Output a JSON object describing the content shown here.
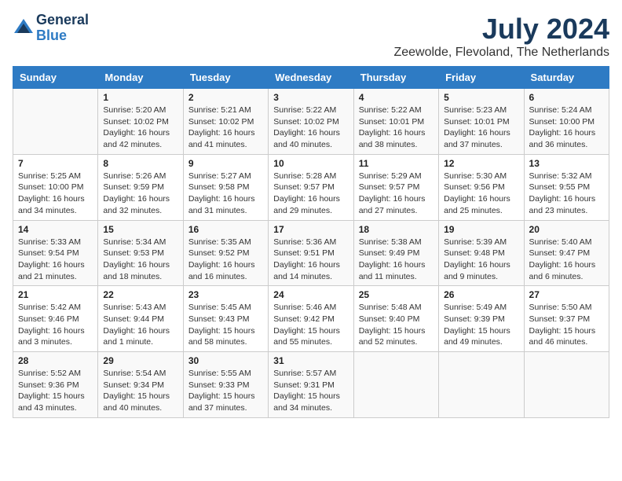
{
  "header": {
    "logo_general": "General",
    "logo_blue": "Blue",
    "month_title": "July 2024",
    "location": "Zeewolde, Flevoland, The Netherlands"
  },
  "weekdays": [
    "Sunday",
    "Monday",
    "Tuesday",
    "Wednesday",
    "Thursday",
    "Friday",
    "Saturday"
  ],
  "weeks": [
    [
      {
        "day": "",
        "info": ""
      },
      {
        "day": "1",
        "info": "Sunrise: 5:20 AM\nSunset: 10:02 PM\nDaylight: 16 hours\nand 42 minutes."
      },
      {
        "day": "2",
        "info": "Sunrise: 5:21 AM\nSunset: 10:02 PM\nDaylight: 16 hours\nand 41 minutes."
      },
      {
        "day": "3",
        "info": "Sunrise: 5:22 AM\nSunset: 10:02 PM\nDaylight: 16 hours\nand 40 minutes."
      },
      {
        "day": "4",
        "info": "Sunrise: 5:22 AM\nSunset: 10:01 PM\nDaylight: 16 hours\nand 38 minutes."
      },
      {
        "day": "5",
        "info": "Sunrise: 5:23 AM\nSunset: 10:01 PM\nDaylight: 16 hours\nand 37 minutes."
      },
      {
        "day": "6",
        "info": "Sunrise: 5:24 AM\nSunset: 10:00 PM\nDaylight: 16 hours\nand 36 minutes."
      }
    ],
    [
      {
        "day": "7",
        "info": "Sunrise: 5:25 AM\nSunset: 10:00 PM\nDaylight: 16 hours\nand 34 minutes."
      },
      {
        "day": "8",
        "info": "Sunrise: 5:26 AM\nSunset: 9:59 PM\nDaylight: 16 hours\nand 32 minutes."
      },
      {
        "day": "9",
        "info": "Sunrise: 5:27 AM\nSunset: 9:58 PM\nDaylight: 16 hours\nand 31 minutes."
      },
      {
        "day": "10",
        "info": "Sunrise: 5:28 AM\nSunset: 9:57 PM\nDaylight: 16 hours\nand 29 minutes."
      },
      {
        "day": "11",
        "info": "Sunrise: 5:29 AM\nSunset: 9:57 PM\nDaylight: 16 hours\nand 27 minutes."
      },
      {
        "day": "12",
        "info": "Sunrise: 5:30 AM\nSunset: 9:56 PM\nDaylight: 16 hours\nand 25 minutes."
      },
      {
        "day": "13",
        "info": "Sunrise: 5:32 AM\nSunset: 9:55 PM\nDaylight: 16 hours\nand 23 minutes."
      }
    ],
    [
      {
        "day": "14",
        "info": "Sunrise: 5:33 AM\nSunset: 9:54 PM\nDaylight: 16 hours\nand 21 minutes."
      },
      {
        "day": "15",
        "info": "Sunrise: 5:34 AM\nSunset: 9:53 PM\nDaylight: 16 hours\nand 18 minutes."
      },
      {
        "day": "16",
        "info": "Sunrise: 5:35 AM\nSunset: 9:52 PM\nDaylight: 16 hours\nand 16 minutes."
      },
      {
        "day": "17",
        "info": "Sunrise: 5:36 AM\nSunset: 9:51 PM\nDaylight: 16 hours\nand 14 minutes."
      },
      {
        "day": "18",
        "info": "Sunrise: 5:38 AM\nSunset: 9:49 PM\nDaylight: 16 hours\nand 11 minutes."
      },
      {
        "day": "19",
        "info": "Sunrise: 5:39 AM\nSunset: 9:48 PM\nDaylight: 16 hours\nand 9 minutes."
      },
      {
        "day": "20",
        "info": "Sunrise: 5:40 AM\nSunset: 9:47 PM\nDaylight: 16 hours\nand 6 minutes."
      }
    ],
    [
      {
        "day": "21",
        "info": "Sunrise: 5:42 AM\nSunset: 9:46 PM\nDaylight: 16 hours\nand 3 minutes."
      },
      {
        "day": "22",
        "info": "Sunrise: 5:43 AM\nSunset: 9:44 PM\nDaylight: 16 hours\nand 1 minute."
      },
      {
        "day": "23",
        "info": "Sunrise: 5:45 AM\nSunset: 9:43 PM\nDaylight: 15 hours\nand 58 minutes."
      },
      {
        "day": "24",
        "info": "Sunrise: 5:46 AM\nSunset: 9:42 PM\nDaylight: 15 hours\nand 55 minutes."
      },
      {
        "day": "25",
        "info": "Sunrise: 5:48 AM\nSunset: 9:40 PM\nDaylight: 15 hours\nand 52 minutes."
      },
      {
        "day": "26",
        "info": "Sunrise: 5:49 AM\nSunset: 9:39 PM\nDaylight: 15 hours\nand 49 minutes."
      },
      {
        "day": "27",
        "info": "Sunrise: 5:50 AM\nSunset: 9:37 PM\nDaylight: 15 hours\nand 46 minutes."
      }
    ],
    [
      {
        "day": "28",
        "info": "Sunrise: 5:52 AM\nSunset: 9:36 PM\nDaylight: 15 hours\nand 43 minutes."
      },
      {
        "day": "29",
        "info": "Sunrise: 5:54 AM\nSunset: 9:34 PM\nDaylight: 15 hours\nand 40 minutes."
      },
      {
        "day": "30",
        "info": "Sunrise: 5:55 AM\nSunset: 9:33 PM\nDaylight: 15 hours\nand 37 minutes."
      },
      {
        "day": "31",
        "info": "Sunrise: 5:57 AM\nSunset: 9:31 PM\nDaylight: 15 hours\nand 34 minutes."
      },
      {
        "day": "",
        "info": ""
      },
      {
        "day": "",
        "info": ""
      },
      {
        "day": "",
        "info": ""
      }
    ]
  ]
}
